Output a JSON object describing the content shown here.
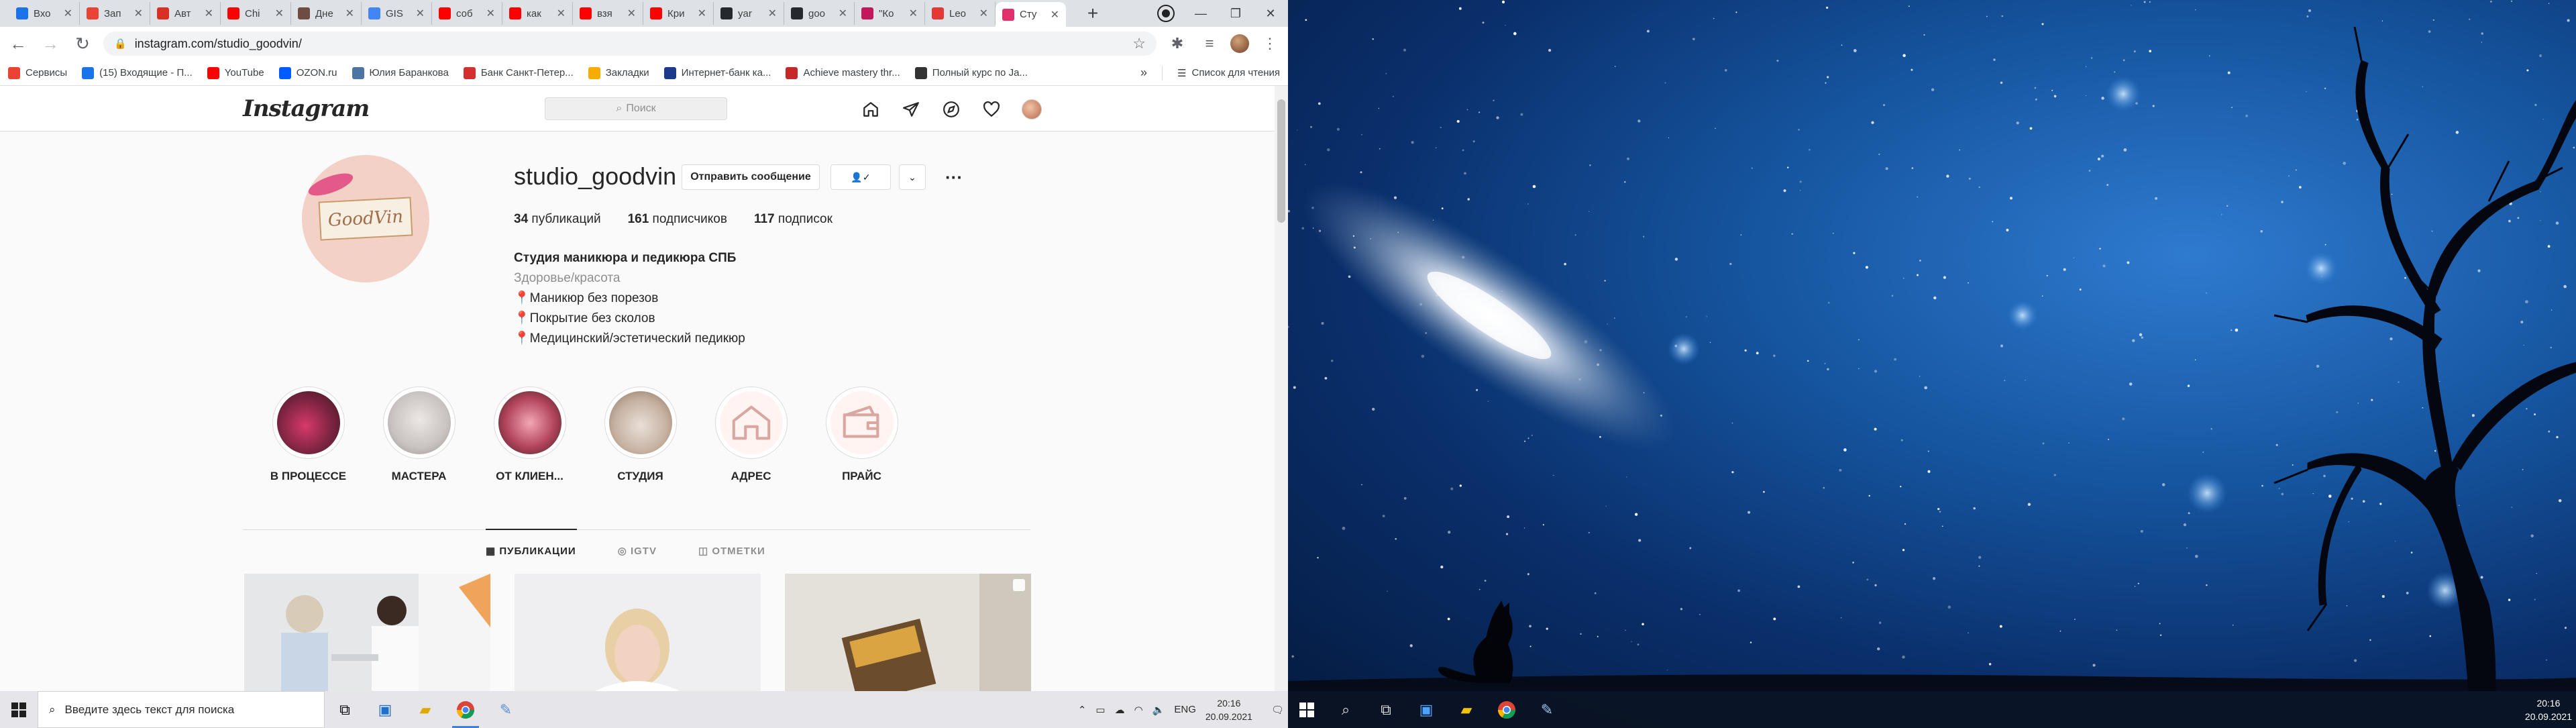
{
  "browser": {
    "tabs": [
      {
        "title": "Вхо",
        "color": "#1a73e8"
      },
      {
        "title": "Зап",
        "color": "#ea4335"
      },
      {
        "title": "Авт",
        "color": "#d93025"
      },
      {
        "title": "Chi",
        "color": "#ff0000"
      },
      {
        "title": "Дне",
        "color": "#6d4c41"
      },
      {
        "title": "GIS",
        "color": "#4285f4"
      },
      {
        "title": "соб",
        "color": "#ff0000"
      },
      {
        "title": "как",
        "color": "#ff0000"
      },
      {
        "title": "взя",
        "color": "#ff0000"
      },
      {
        "title": "Кри",
        "color": "#ff0000"
      },
      {
        "title": "yar",
        "color": "#24292e"
      },
      {
        "title": "goo",
        "color": "#24292e"
      },
      {
        "title": "\"Ко",
        "color": "#c2185b"
      },
      {
        "title": "Leo",
        "color": "#e53935"
      },
      {
        "title": "Сту",
        "color": "#e1306c"
      }
    ],
    "url": "instagram.com/studio_goodvin/",
    "bookmarks": [
      {
        "label": "Сервисы",
        "color": "#ea4335"
      },
      {
        "label": "(15) Входящие - П...",
        "color": "#1a73e8"
      },
      {
        "label": "YouTube",
        "color": "#ff0000"
      },
      {
        "label": "OZON.ru",
        "color": "#005bff"
      },
      {
        "label": "Юлия Баранкова",
        "color": "#4c75a3"
      },
      {
        "label": "Банк Санкт-Петер...",
        "color": "#d32f2f"
      },
      {
        "label": "Закладки",
        "color": "#f9ab00"
      },
      {
        "label": "Интернет-банк ка...",
        "color": "#1a3a8a"
      },
      {
        "label": "Achieve mastery thr...",
        "color": "#c62828"
      },
      {
        "label": "Полный курс по Ja...",
        "color": "#333333"
      }
    ],
    "bookmarks_more": "»",
    "reading_list": "Список для чтения"
  },
  "instagram": {
    "logo": "Instagram",
    "search_placeholder": "Поиск",
    "avatar_text": "GoodVin",
    "username": "studio_goodvin",
    "message_button": "Отправить сообщение",
    "follow_icon": "👤✓",
    "stats": {
      "posts_count": "34",
      "posts_label": "публикаций",
      "followers_count": "161",
      "followers_label": "подписчиков",
      "following_count": "117",
      "following_label": "подписок"
    },
    "bio": {
      "name": "Студия маникюра и педикюра СПБ",
      "category": "Здоровье/красота",
      "line1": "Маникюр без порезов",
      "line2": "Покрытие без сколов",
      "line3": "Медицинский/эстетический педикюр"
    },
    "highlights": [
      {
        "label": "В ПРОЦЕССЕ",
        "bg": "radial-gradient(circle at 45% 55%,#d63a6a,#7a2340 55%,#3a1a20)"
      },
      {
        "label": "МАСТЕРА",
        "bg": "radial-gradient(circle at 50% 45%,#ece8e6,#c8c2c0 60%,#9a9090)"
      },
      {
        "label": "ОТ КЛИЕН...",
        "bg": "radial-gradient(circle at 50% 50%,#f4a6b6,#b2445c 55%,#3a2020)"
      },
      {
        "label": "СТУДИЯ",
        "bg": "radial-gradient(circle at 50% 55%,#e9e0d8,#c7b2a2 55%,#8a6f5e)"
      },
      {
        "label": "АДРЕС",
        "bg": "#fff4f2"
      },
      {
        "label": "ПРАЙС",
        "bg": "#fff4f2"
      }
    ],
    "tabs": {
      "posts": "ПУБЛИКАЦИИ",
      "igtv": "IGTV",
      "tagged": "ОТМЕТКИ"
    }
  },
  "taskbar_left": {
    "search_placeholder": "Введите здесь текст для поиска",
    "lang": "ENG",
    "time": "20:16",
    "date": "20.09.2021"
  },
  "taskbar_right": {
    "time": "20:16",
    "date": "20.09.2021"
  }
}
